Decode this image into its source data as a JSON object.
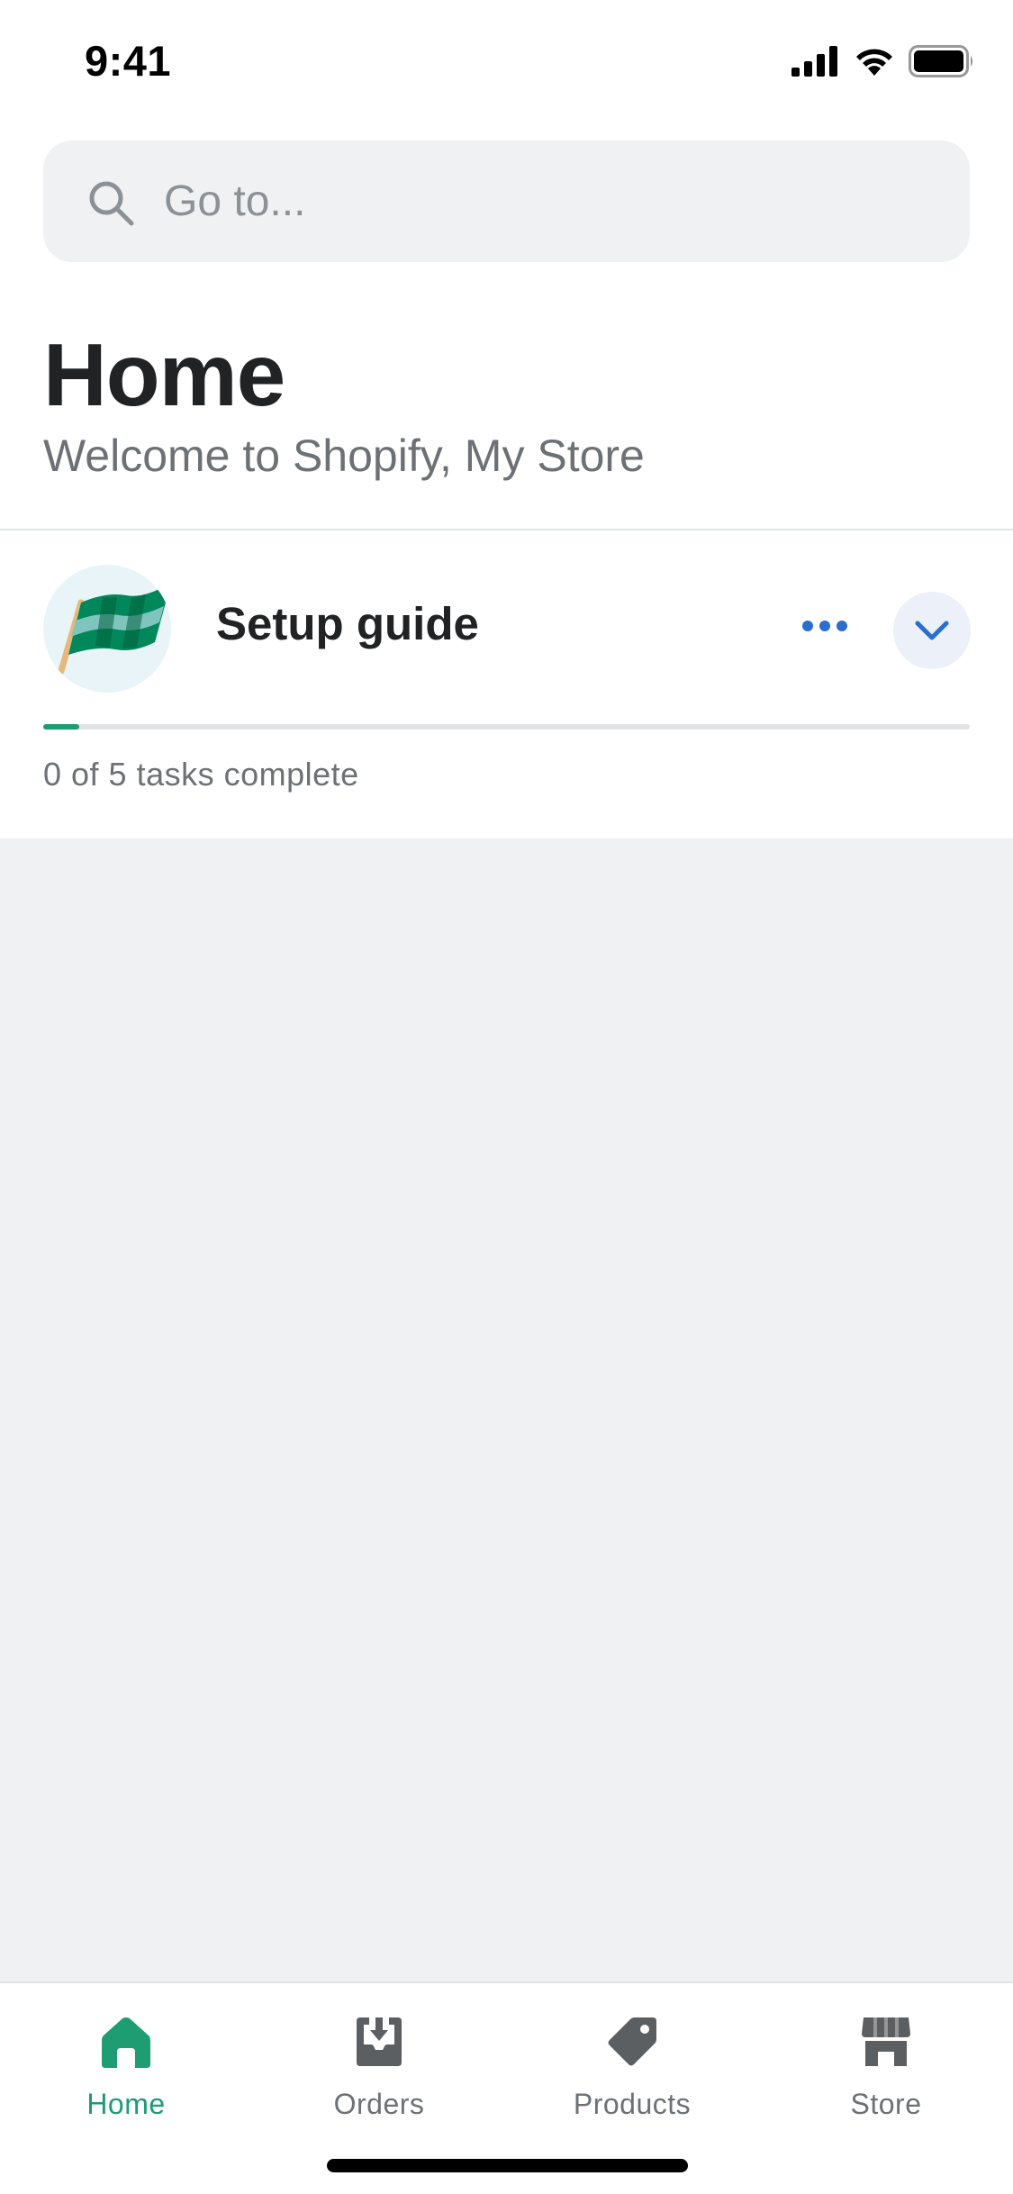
{
  "status_bar": {
    "time": "9:41"
  },
  "search": {
    "placeholder": "Go to..."
  },
  "header": {
    "title": "Home",
    "subtitle": "Welcome to Shopify, My Store"
  },
  "setup_guide": {
    "title": "Setup guide",
    "progress_text": "0 of 5 tasks complete",
    "tasks_completed": 0,
    "tasks_total": 5
  },
  "tab_bar": {
    "tabs": [
      {
        "label": "Home",
        "icon": "home-icon",
        "active": true
      },
      {
        "label": "Orders",
        "icon": "orders-icon",
        "active": false
      },
      {
        "label": "Products",
        "icon": "products-tag-icon",
        "active": false
      },
      {
        "label": "Store",
        "icon": "store-icon",
        "active": false
      }
    ]
  },
  "colors": {
    "accent": "#1e9c72",
    "link_blue": "#2c6ecb",
    "inactive_icon": "#5c5f62",
    "background": "#f0f1f3"
  }
}
